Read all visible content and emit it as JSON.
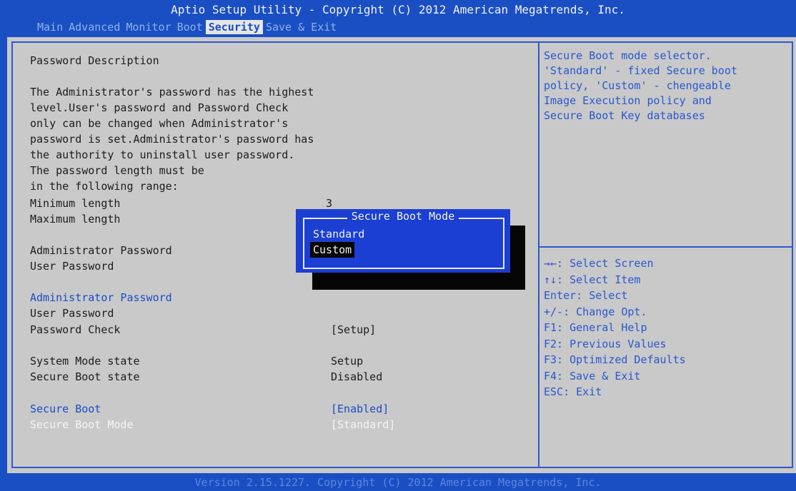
{
  "header": {
    "title": "Aptio Setup Utility - Copyright (C) 2012 American Megatrends, Inc.",
    "tabs": [
      "Main",
      "Advanced",
      "Monitor",
      "Boot",
      "Security",
      "Save & Exit"
    ],
    "active_tab": "Security"
  },
  "content": {
    "password_description_heading": "Password Description",
    "description_lines": [
      "The Administrator's password has the highest",
      "level.User's password and Password Check",
      "only can be changed when Administrator's",
      "password is set.Administrator's password has",
      "the authority to uninstall user password.",
      "The password length must be",
      "in the following range:"
    ],
    "min_length_label": "Minimum length",
    "min_length_value": "3",
    "max_length_label": "Maximum length",
    "admin_password_status_label": "Administrator Password",
    "user_password_status_label": "User Password",
    "admin_password_item": "Administrator Password",
    "user_password_item": "User Password",
    "password_check_label": "Password Check",
    "password_check_value": "[Setup]",
    "system_mode_label": "System Mode state",
    "system_mode_value": "Setup",
    "secure_boot_state_label": "Secure Boot state",
    "secure_boot_state_value": "Disabled",
    "secure_boot_label": "Secure Boot",
    "secure_boot_value": "[Enabled]",
    "secure_boot_mode_label": "Secure Boot Mode",
    "secure_boot_mode_value": "[Standard]"
  },
  "popup": {
    "title": "Secure Boot Mode",
    "options": [
      "Standard",
      "Custom"
    ],
    "highlighted": "Custom"
  },
  "help": {
    "text": "Secure Boot mode selector.\n'Standard' - fixed Secure boot\npolicy, 'Custom' - chengeable\nImage Execution policy and\nSecure Boot Key databases",
    "keys": [
      "→←: Select Screen",
      "↑↓: Select Item",
      "Enter: Select",
      "+/-: Change Opt.",
      "F1: General Help",
      "F2: Previous Values",
      "F3: Optimized Defaults",
      "F4: Save & Exit",
      "ESC: Exit"
    ]
  },
  "footer": {
    "text": "Version 2.15.1227. Copyright (C) 2012 American Megatrends, Inc."
  },
  "colors": {
    "background_blue": "#1a4fc4",
    "panel_gray": "#c9c9c9",
    "highlight_blue": "#1d4bc7",
    "popup_blue": "#1b3fd2"
  }
}
